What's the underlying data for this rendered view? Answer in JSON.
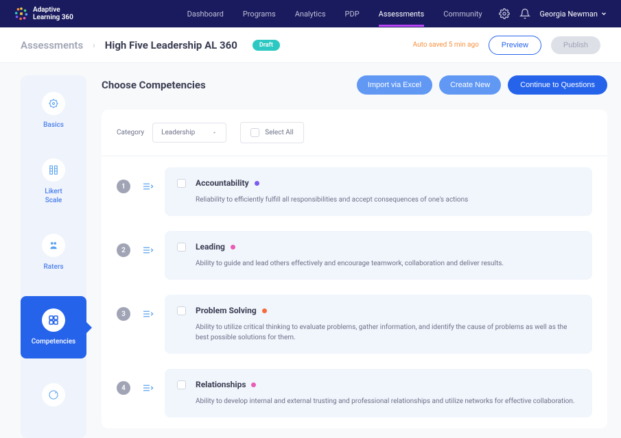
{
  "brand": {
    "line1": "Adaptive",
    "line2": "Learning 360"
  },
  "nav": {
    "items": [
      "Dashboard",
      "Programs",
      "Analytics",
      "PDP",
      "Assessments",
      "Community"
    ],
    "active": 4
  },
  "user": {
    "name": "Georgia Newman"
  },
  "breadcrumb": {
    "root": "Assessments",
    "title": "High Five Leadership AL 360",
    "badge": "Draft"
  },
  "autosave": "Auto saved 5 min ago",
  "buttons": {
    "preview": "Preview",
    "publish": "Publish",
    "import": "Import via Excel",
    "create": "Create New",
    "continue": "Continue to Questions"
  },
  "main": {
    "title": "Choose Competencies"
  },
  "filter": {
    "label": "Category",
    "value": "Leadership",
    "selectAll": "Select All"
  },
  "sidebar": {
    "items": [
      {
        "label": "Basics"
      },
      {
        "label": "Likert\nScale"
      },
      {
        "label": "Raters"
      },
      {
        "label": "Competencies"
      },
      {
        "label": ""
      }
    ],
    "active": 3
  },
  "competencies": [
    {
      "num": "1",
      "title": "Accountability",
      "color": "#7a5cf0",
      "desc": "Reliability to efficiently fulfill all responsibilities and accept consequences of one's actions"
    },
    {
      "num": "2",
      "title": "Leading",
      "color": "#e85db5",
      "desc": "Ability to guide and lead others effectively and encourage teamwork, collaboration and deliver results."
    },
    {
      "num": "3",
      "title": "Problem Solving",
      "color": "#f56b3b",
      "desc": "Ability to utilize critical thinking to evaluate problems, gather information, and identify the cause of problems as well as the best possible solutions for them."
    },
    {
      "num": "4",
      "title": "Relationships",
      "color": "#e85db5",
      "desc": "Ability to develop internal and external trusting and professional relationships and utilize networks for effective collaboration."
    }
  ]
}
